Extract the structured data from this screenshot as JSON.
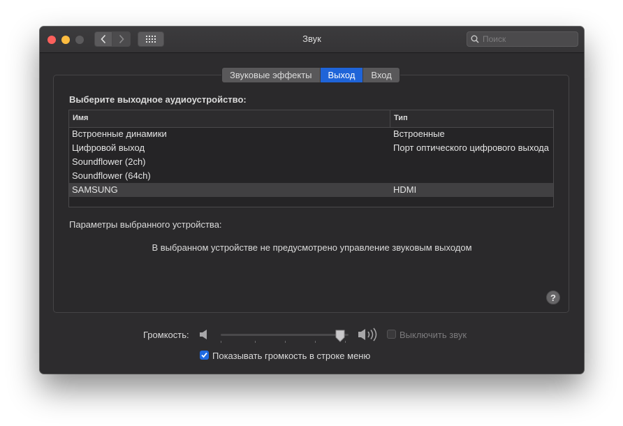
{
  "window": {
    "title": "Звук",
    "search_placeholder": "Поиск"
  },
  "tabs": [
    {
      "label": "Звуковые эффекты",
      "active": false
    },
    {
      "label": "Выход",
      "active": true
    },
    {
      "label": "Вход",
      "active": false
    }
  ],
  "output": {
    "choose_label": "Выберите выходное аудиоустройство:",
    "columns": {
      "name": "Имя",
      "type": "Тип"
    },
    "devices": [
      {
        "name": "Встроенные динамики",
        "type": "Встроенные",
        "selected": false
      },
      {
        "name": "Цифровой выход",
        "type": "Порт оптического цифрового выхода",
        "selected": false
      },
      {
        "name": "Soundflower (2ch)",
        "type": "",
        "selected": false
      },
      {
        "name": "Soundflower (64ch)",
        "type": "",
        "selected": false
      },
      {
        "name": "SAMSUNG",
        "type": "HDMI",
        "selected": true
      }
    ],
    "params_label": "Параметры выбранного устройства:",
    "no_control_message": "В выбранном устройстве не предусмотрено управление звуковым выходом",
    "help": "?"
  },
  "volume": {
    "label": "Громкость:",
    "level": 0.97,
    "mute_label": "Выключить звук",
    "mute_checked": false,
    "show_in_menu_label": "Показывать громкость в строке меню",
    "show_in_menu_checked": true
  },
  "icons": {
    "back": "chevron-left-icon",
    "forward": "chevron-right-icon",
    "show_all": "grid-icon",
    "search": "search-icon",
    "volume_low": "speaker-low-icon",
    "volume_high": "speaker-high-icon",
    "help": "help-icon",
    "check": "checkmark-icon"
  },
  "colors": {
    "accent": "#1f64d8",
    "window_bg": "#2d2c2e",
    "close": "#fc605c",
    "minimize": "#fdbc40"
  }
}
